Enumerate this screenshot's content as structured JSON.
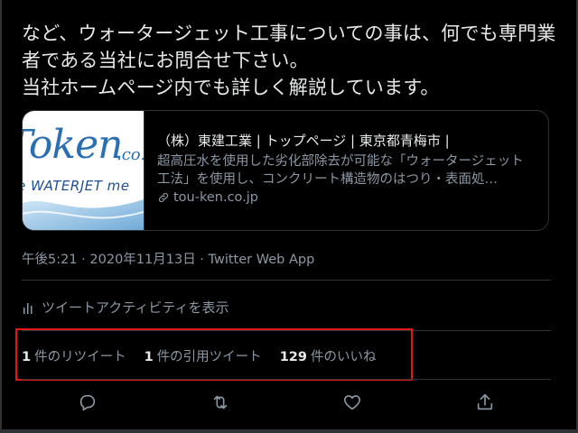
{
  "tweet": {
    "text": "など、ウォータージェット工事についての事は、何でも専門業者である当社にお問合せ下さい。\n当社ホームページ内でも詳しく解説しています。"
  },
  "card": {
    "logo_main": "Token",
    "logo_suffix": ".co.",
    "logo_tagline": "e WATERJET me",
    "title": "（株）東建工業 | トップページ | 東京都青梅市 |",
    "desc_line1": "超高圧水を使用した劣化部除去が可能な「ウォータージェット",
    "desc_line2": "工法」を使用し、コンクリート構造物のはつり・表面処…",
    "domain": "tou-ken.co.jp",
    "domain_icon": "link-icon"
  },
  "meta": {
    "timestamp": "午後5:21 · 2020年11月13日 · Twitter Web App"
  },
  "activity": {
    "label": "ツイートアクティビティを表示",
    "icon": "bar-chart-icon"
  },
  "stats": {
    "retweets_count": "1",
    "retweets_label": "件のリツイート",
    "quotes_count": "1",
    "quotes_label": "件の引用ツイート",
    "likes_count": "129",
    "likes_label": "件のいいね"
  },
  "actions": [
    "reply-icon",
    "retweet-icon",
    "like-icon",
    "share-icon"
  ],
  "colors": {
    "background": "#000000",
    "text": "#e7e9ea",
    "secondary": "#8b98a5",
    "border": "#2f3336",
    "highlight": "#e01818"
  }
}
